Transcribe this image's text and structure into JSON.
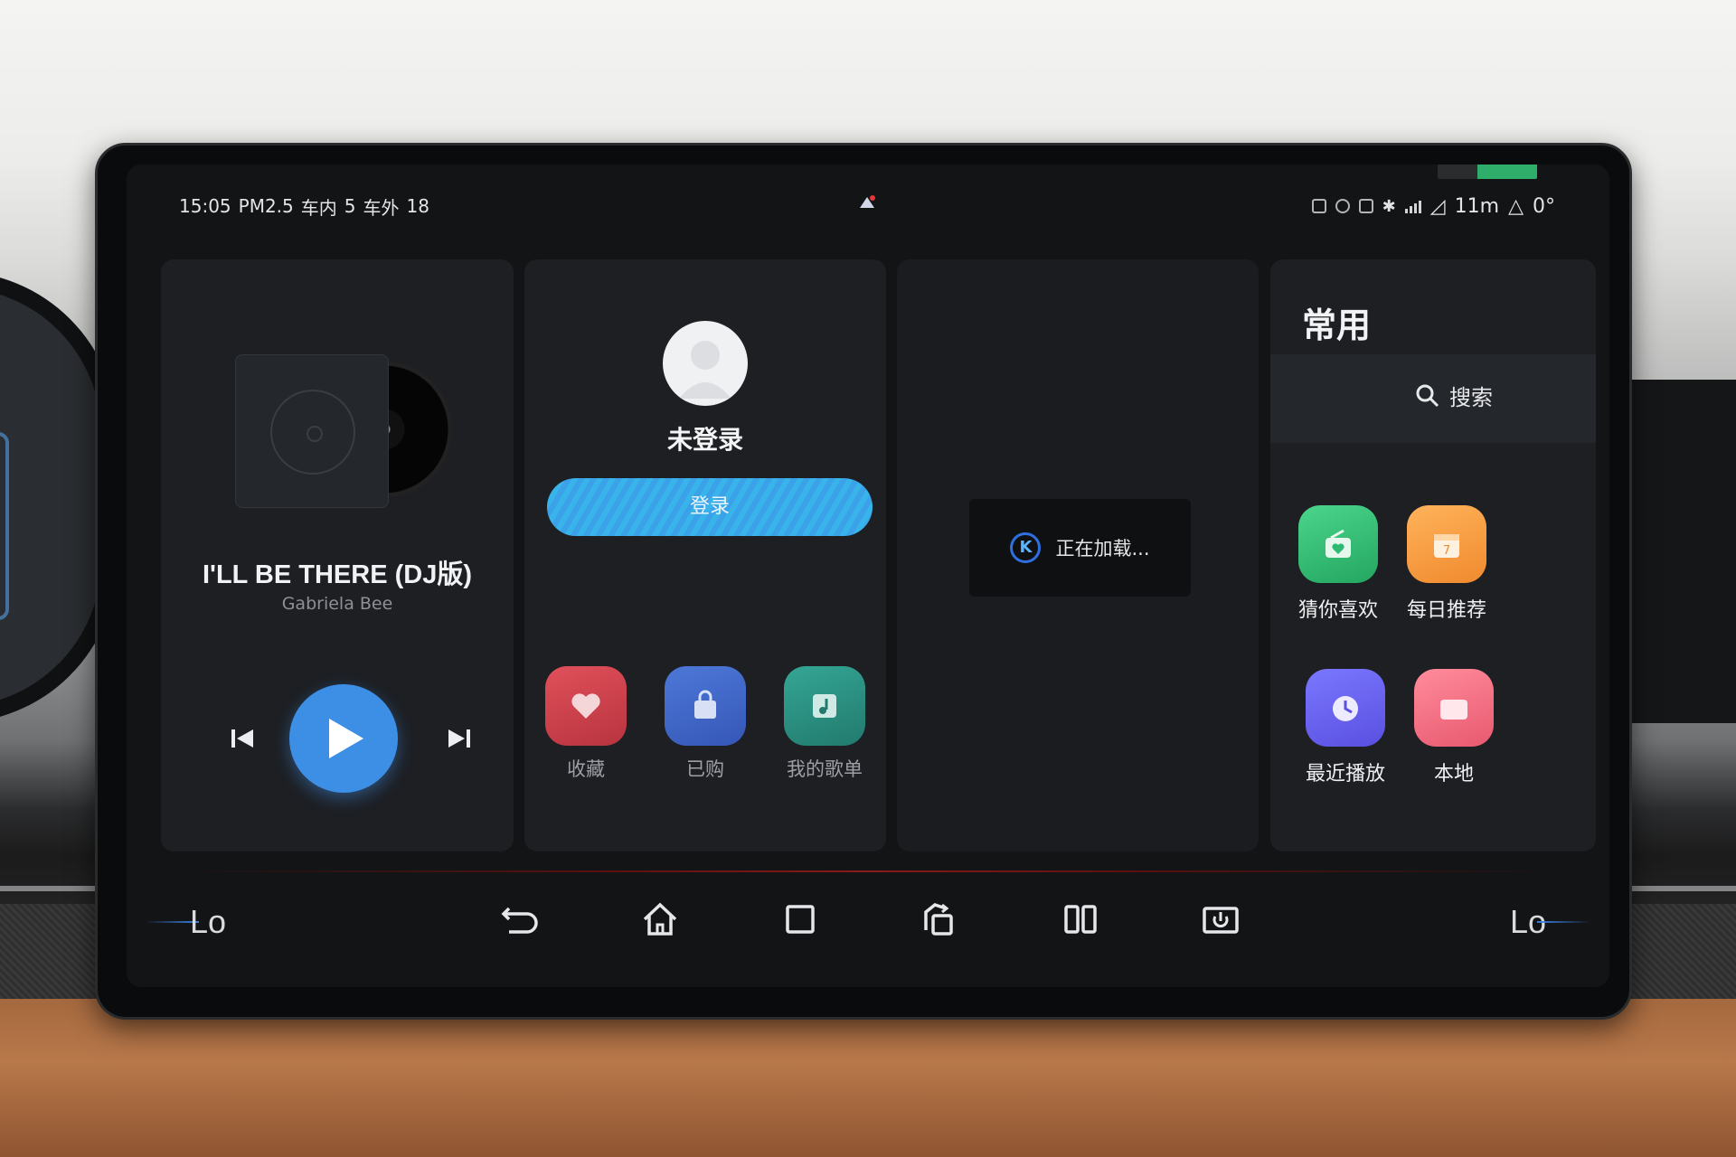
{
  "status_bar": {
    "time": "15:05",
    "pm25_label": "PM2.5",
    "inside_label": "车内",
    "inside_value": "5",
    "outside_label": "车外",
    "outside_value": "18",
    "right_value_1": "11m",
    "right_value_2": "0°",
    "icons": [
      "notification-icon",
      "eco-icon",
      "location-icon",
      "data-icon",
      "bluetooth-icon",
      "signal-icon",
      "network-icon",
      "triangle-icon"
    ]
  },
  "player": {
    "song_title": "I'LL BE THERE (DJ版)",
    "artist": "Gabriela Bee",
    "accent_color": "#3d8fe6"
  },
  "user": {
    "login_status": "未登录",
    "login_button": "登录",
    "quick_items": [
      {
        "label": "收藏",
        "icon": "heart-icon"
      },
      {
        "label": "已购",
        "icon": "bag-icon"
      },
      {
        "label": "我的歌单",
        "icon": "playlist-icon"
      }
    ]
  },
  "loading": {
    "logo_letter": "K",
    "text": "正在加载..."
  },
  "common": {
    "title": "常用",
    "search_label": "搜索",
    "items": [
      {
        "label": "猜你喜欢",
        "icon": "radio-icon",
        "color": "#2fba72"
      },
      {
        "label": "每日推荐",
        "icon": "calendar-icon",
        "color": "#f59a3c"
      },
      {
        "label": "最近播放",
        "icon": "clock-icon",
        "color": "#6661f0"
      },
      {
        "label": "本地",
        "icon": "folder-icon",
        "color": "#ef6d80"
      }
    ],
    "calendar_day": "7"
  },
  "nav": {
    "logo_left": "Lo",
    "logo_right": "Lo",
    "buttons": [
      "back-icon",
      "home-icon",
      "recent-apps-icon",
      "rotate-icon",
      "split-screen-icon",
      "power-icon"
    ]
  }
}
